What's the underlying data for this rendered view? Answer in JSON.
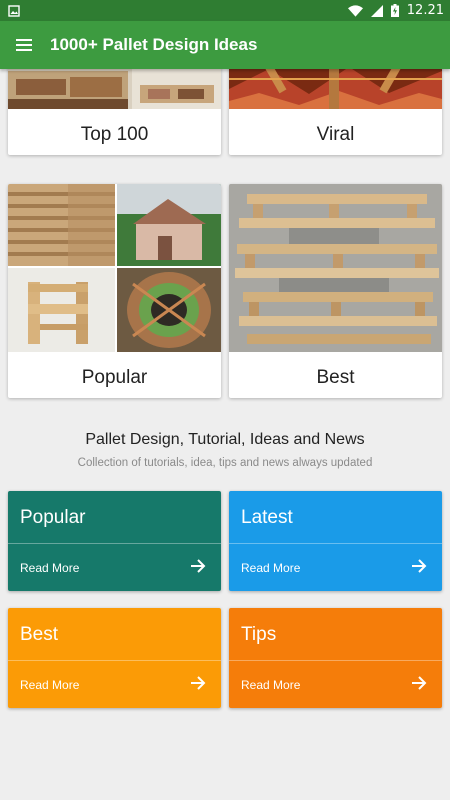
{
  "status_bar": {
    "time": "12.21"
  },
  "app_bar": {
    "title": "1000+ Pallet Design Ideas"
  },
  "categories": [
    {
      "label": "Top 100"
    },
    {
      "label": "Viral"
    },
    {
      "label": "Popular"
    },
    {
      "label": "Best"
    }
  ],
  "section": {
    "title": "Pallet Design, Tutorial, Ideas and News",
    "subtitle": "Collection of tutorials, idea, tips and news always updated"
  },
  "tiles": [
    {
      "title": "Popular",
      "action": "Read More",
      "color": "#16796a"
    },
    {
      "title": "Latest",
      "action": "Read More",
      "color": "#1a9be8"
    },
    {
      "title": "Best",
      "action": "Read More",
      "color": "#fb9b06"
    },
    {
      "title": "Tips",
      "action": "Read More",
      "color": "#f57d0a"
    }
  ]
}
